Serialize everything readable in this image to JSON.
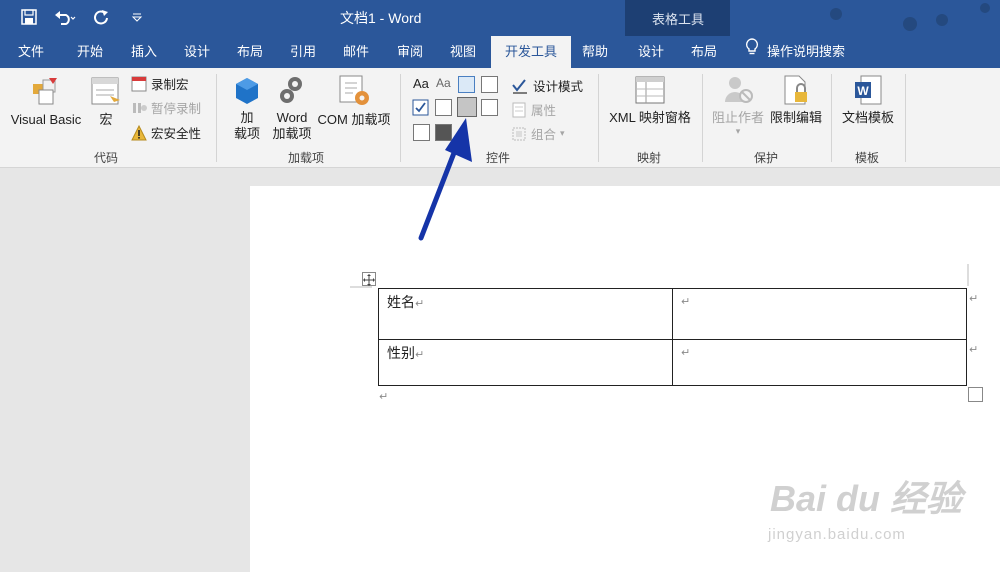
{
  "window": {
    "title": "文档1  -  Word",
    "contextual_title": "表格工具"
  },
  "quick_access": {
    "icons": [
      "save-icon",
      "undo-icon",
      "redo-icon",
      "customize-icon"
    ]
  },
  "tabs": [
    {
      "label": "文件"
    },
    {
      "label": "开始"
    },
    {
      "label": "插入"
    },
    {
      "label": "设计"
    },
    {
      "label": "布局"
    },
    {
      "label": "引用"
    },
    {
      "label": "邮件"
    },
    {
      "label": "审阅"
    },
    {
      "label": "视图"
    },
    {
      "label": "开发工具"
    },
    {
      "label": "帮助"
    },
    {
      "label": "设计"
    },
    {
      "label": "布局"
    }
  ],
  "search": {
    "label": "操作说明搜索"
  },
  "ribbon": {
    "code": {
      "label": "代码",
      "visual_basic": "Visual Basic",
      "macros": "宏",
      "record_macro": "录制宏",
      "pause_recording": "暂停录制",
      "macro_security": "宏安全性"
    },
    "addins": {
      "label": "加载项",
      "addins_line1": "加",
      "addins_line2": "载项",
      "word_addins_line1": "Word",
      "word_addins_line2": "加载项",
      "com_addins": "COM 加载项"
    },
    "controls": {
      "label": "控件",
      "design_mode": "设计模式",
      "properties": "属性",
      "group": "组合"
    },
    "mapping": {
      "label": "映射",
      "xml_pane": "XML 映射窗格"
    },
    "protect": {
      "label": "保护",
      "block_authors": "阻止作者",
      "restrict_editing": "限制编辑"
    },
    "templates": {
      "label": "模板",
      "document_template": "文档模板"
    }
  },
  "document": {
    "table": [
      [
        "姓名",
        ""
      ],
      [
        "性别",
        ""
      ]
    ],
    "paragraph_mark": "↵"
  },
  "watermark": {
    "text": "Bai du 经验",
    "sub": "jingyan.baidu.com"
  },
  "colors": {
    "title_bar": "#2b579a",
    "contextual_band": "#1d3f73",
    "ribbon_bg": "#f3f3f3",
    "arrow": "#1534a8"
  }
}
